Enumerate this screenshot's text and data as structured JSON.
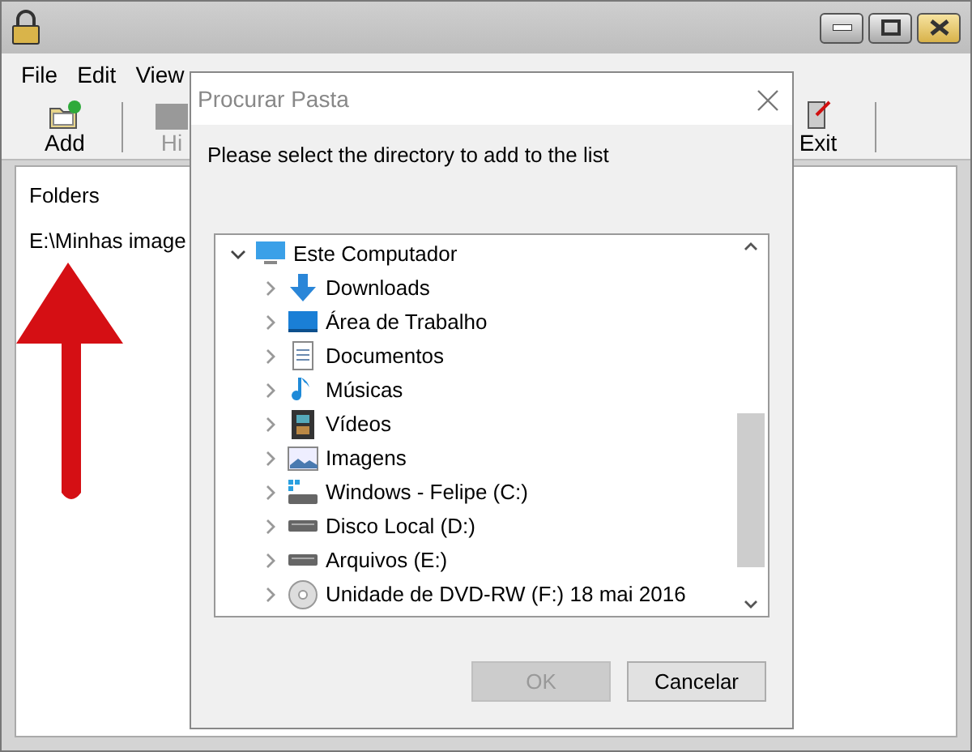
{
  "window": {
    "menu": [
      "File",
      "Edit",
      "View"
    ],
    "toolbar": [
      {
        "label": "Add",
        "disabled": false,
        "kind": "add"
      },
      {
        "label": "Hi",
        "disabled": true,
        "kind": "hide"
      },
      {
        "label": "Exit",
        "disabled": false,
        "kind": "exit"
      }
    ],
    "list": [
      "Folders",
      "E:\\Minhas image"
    ]
  },
  "dialog": {
    "title": "Procurar Pasta",
    "message": "Please select the directory to add to the list",
    "tree": [
      {
        "label": "Este Computador",
        "kind": "computer",
        "expanded": true,
        "children": [
          {
            "label": "Downloads",
            "kind": "downloads",
            "expanded": false
          },
          {
            "label": "Área de Trabalho",
            "kind": "desktop",
            "expanded": false
          },
          {
            "label": "Documentos",
            "kind": "documents",
            "expanded": false
          },
          {
            "label": "Músicas",
            "kind": "music",
            "expanded": false
          },
          {
            "label": "Vídeos",
            "kind": "videos",
            "expanded": false
          },
          {
            "label": "Imagens",
            "kind": "pictures",
            "expanded": false
          },
          {
            "label": "Windows - Felipe (C:)",
            "kind": "sysdrive",
            "expanded": false
          },
          {
            "label": "Disco Local (D:)",
            "kind": "drive",
            "expanded": false
          },
          {
            "label": "Arquivos (E:)",
            "kind": "drive",
            "expanded": false
          },
          {
            "label": "Unidade de DVD-RW (F:) 18 mai 2016",
            "kind": "dvd",
            "expanded": false
          }
        ]
      }
    ],
    "buttons": [
      {
        "label": "OK",
        "disabled": true
      },
      {
        "label": "Cancelar",
        "disabled": false
      }
    ]
  }
}
